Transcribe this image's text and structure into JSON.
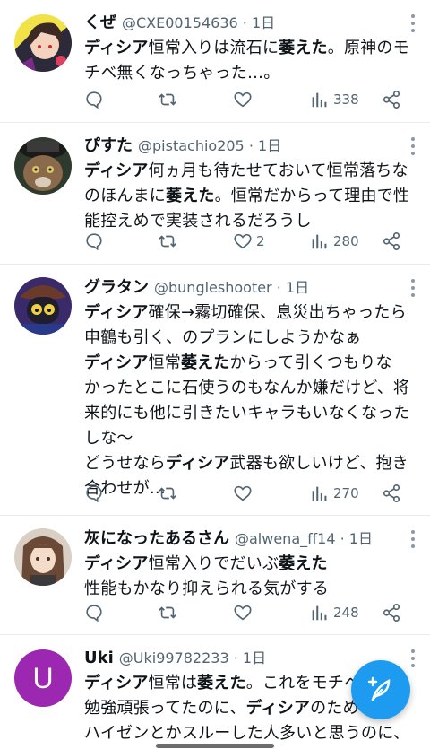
{
  "tweets": [
    {
      "name": "くぜ",
      "handle": "@CXE00154636 · 1日",
      "avatar": "anime-character",
      "lines": [
        [
          {
            "t": "ディシア",
            "b": true
          },
          {
            "t": "恒常入りは流石に",
            "b": false
          },
          {
            "t": "萎えた",
            "b": true
          },
          {
            "t": "。原神のモ",
            "b": false
          }
        ],
        [
          {
            "t": "チベ無くなっちゃった…。",
            "b": false
          }
        ]
      ],
      "reply": "",
      "retweet": "",
      "like": "",
      "views": "338"
    },
    {
      "name": "ぴすた",
      "handle": "@pistachio205 · 1日",
      "avatar": "cat-with-hat",
      "lines": [
        [
          {
            "t": "ディシア",
            "b": true
          },
          {
            "t": "何ヵ月も待たせておいて恒常落ちな",
            "b": false
          }
        ],
        [
          {
            "t": "のほんまに",
            "b": false
          },
          {
            "t": "萎えた",
            "b": true
          },
          {
            "t": "。恒常だからって理由で性",
            "b": false
          }
        ],
        [
          {
            "t": "能控えめで実装されるだろうし",
            "b": false
          }
        ]
      ],
      "reply": "",
      "retweet": "",
      "like": "2",
      "views": "280"
    },
    {
      "name": "グラタン",
      "handle": "@bungleshooter · 1日",
      "avatar": "cat-character",
      "lines": [
        [
          {
            "t": "ディシア",
            "b": true
          },
          {
            "t": "確保→霧切確保、息災出ちゃったら",
            "b": false
          }
        ],
        [
          {
            "t": "申鶴も引く、のプランにしようかなぁ",
            "b": false
          }
        ],
        [
          {
            "t": "ディシア",
            "b": true
          },
          {
            "t": "恒常",
            "b": false
          },
          {
            "t": "萎えた",
            "b": true
          },
          {
            "t": "からって引くつもりな",
            "b": false
          }
        ],
        [
          {
            "t": "かったとこに石使うのもなんか嫌だけど、将",
            "b": false
          }
        ],
        [
          {
            "t": "来的にも他に引きたいキャラもいなくなった",
            "b": false
          }
        ],
        [
          {
            "t": "しな〜",
            "b": false
          }
        ],
        [
          {
            "t": "どうせなら",
            "b": false
          },
          {
            "t": "ディシア",
            "b": true
          },
          {
            "t": "武器も欲しいけど、抱き",
            "b": false
          }
        ],
        [
          {
            "t": "合わせが…",
            "b": false
          }
        ]
      ],
      "reply": "",
      "retweet": "",
      "like": "",
      "views": "270"
    },
    {
      "name": "灰になったあるさん",
      "handle": "@alwena_ff14 · 1日",
      "avatar": "anime-girl",
      "lines": [
        [
          {
            "t": "ディシア",
            "b": true
          },
          {
            "t": "恒常入りでだいぶ",
            "b": false
          },
          {
            "t": "萎えた",
            "b": true
          }
        ],
        [
          {
            "t": "性能もかなり抑えられる気がする",
            "b": false
          }
        ]
      ],
      "reply": "",
      "retweet": "",
      "like": "",
      "views": "248"
    },
    {
      "name": "Uki",
      "handle": "@Uki99782233 · 1日",
      "avatar": "U",
      "lines": [
        [
          {
            "t": "ディシア",
            "b": true
          },
          {
            "t": "恒常は",
            "b": false
          },
          {
            "t": "萎えた",
            "b": true
          },
          {
            "t": "。これをモチベ",
            "b": false
          }
        ],
        [
          {
            "t": "勉強頑張ってたのに、",
            "b": false
          },
          {
            "t": "ディシア",
            "b": true
          },
          {
            "t": "のため",
            "b": false
          }
        ],
        [
          {
            "t": "ハイゼンとかスルーした人多いと思うのに、",
            "b": false
          }
        ]
      ],
      "reply": "",
      "retweet": "",
      "like": "",
      "views": ""
    }
  ],
  "colors": {
    "text": "#0f1419",
    "secondary": "#536471",
    "accent": "#1d9bf0",
    "uki_avatar": "#9c27b0"
  },
  "fab_icon": "compose-feather-icon"
}
